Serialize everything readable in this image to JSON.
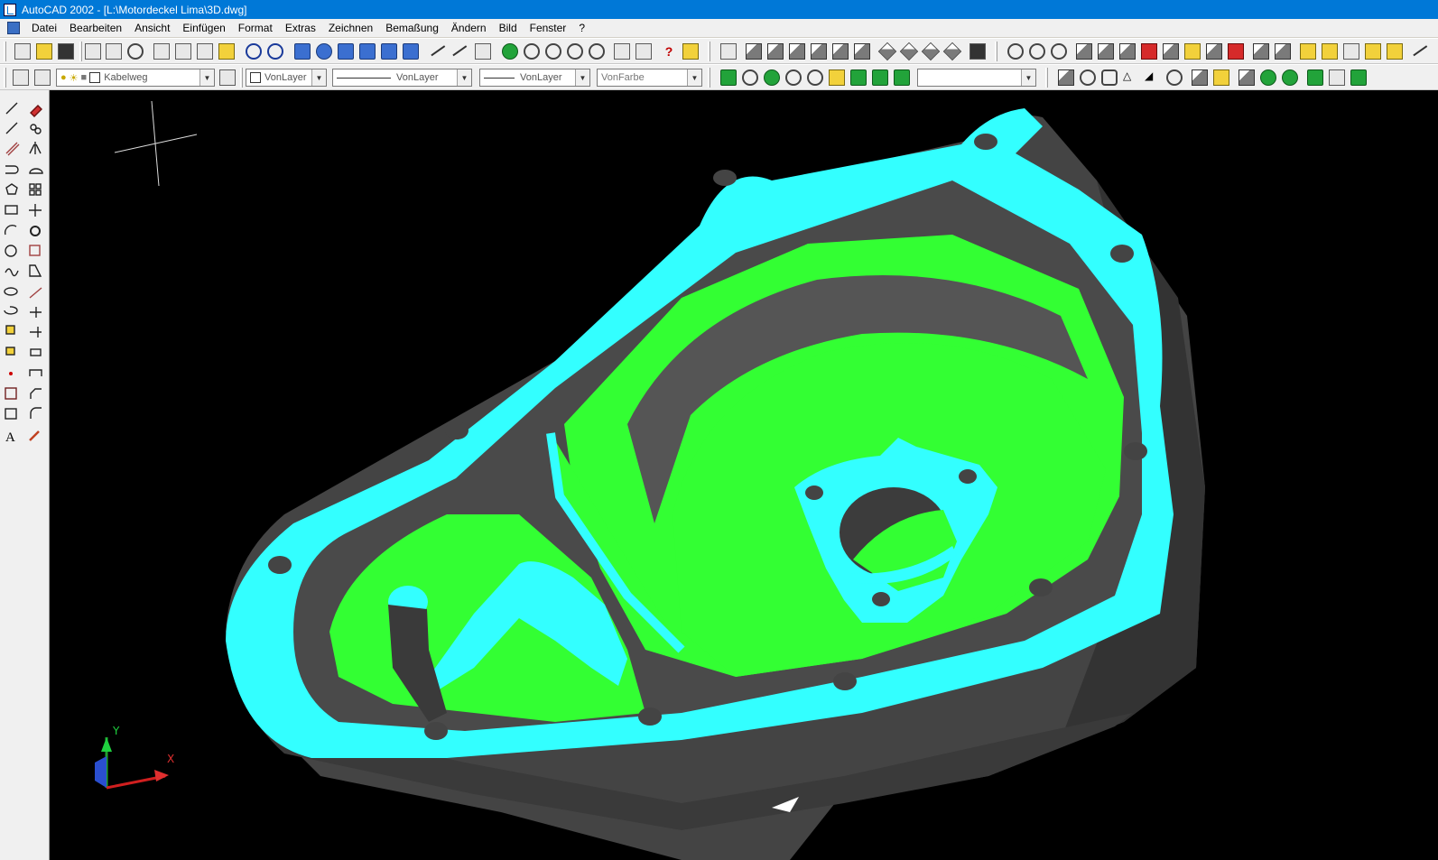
{
  "window": {
    "title": "AutoCAD 2002 - [L:\\Motordeckel Lima\\3D.dwg]"
  },
  "menu": [
    "Datei",
    "Bearbeiten",
    "Ansicht",
    "Einfügen",
    "Format",
    "Extras",
    "Zeichnen",
    "Bemaßung",
    "Ändern",
    "Bild",
    "Fenster",
    "?"
  ],
  "properties_bar": {
    "layer": "Kabelweg",
    "color": "VonLayer",
    "linetype": "VonLayer",
    "lineweight": "VonLayer",
    "plotstyle": "VonFarbe",
    "ucs": ""
  },
  "viewport": {
    "background": "#000000",
    "model_colors": {
      "flange": "#33ffff",
      "floor": "#33ff33",
      "wall": "#4a4a4a"
    },
    "ucs_labels": {
      "x": "X",
      "y": "Y"
    }
  },
  "icons": {
    "standard_toolbar": [
      "new",
      "open",
      "save",
      "print",
      "preview",
      "find",
      "cut",
      "copy",
      "paste",
      "match-properties",
      "undo",
      "redo",
      "hyperlink",
      "today",
      "meeting",
      "publish",
      "web",
      "point-filter",
      "ucs",
      "named-views",
      "pan",
      "zoom-realtime",
      "zoom-window",
      "zoom-previous",
      "aerial",
      "properties",
      "designcenter",
      "help",
      "dbconnect"
    ],
    "draw_toolbar": [
      "line",
      "construction-line",
      "multiline",
      "polyline",
      "polygon",
      "rectangle",
      "arc",
      "circle",
      "spline",
      "ellipse",
      "ellipse-arc",
      "insert-block",
      "make-block",
      "point",
      "hatch",
      "region",
      "multiline-text"
    ],
    "modify_toolbar": [
      "erase",
      "copy-object",
      "mirror",
      "offset",
      "array",
      "move",
      "rotate",
      "scale",
      "stretch",
      "trim",
      "extend",
      "break",
      "chamfer",
      "fillet",
      "explode"
    ]
  }
}
